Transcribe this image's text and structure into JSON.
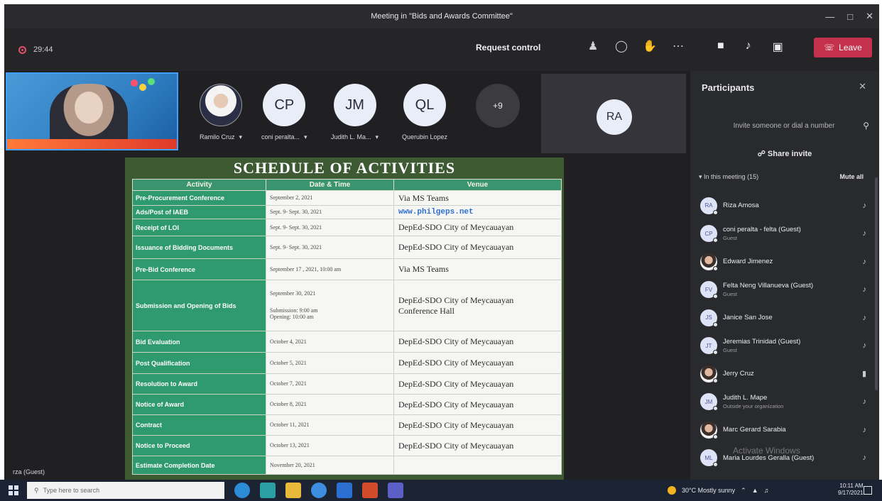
{
  "window": {
    "title": "Meeting in \"Bids and Awards Committee\"",
    "minimize_icon": "minimize-icon",
    "maximize_icon": "maximize-icon",
    "close_icon": "close-icon"
  },
  "toolbar": {
    "timer": "29:44",
    "request_control": "Request control",
    "leave_label": "Leave"
  },
  "participants_stage": [
    {
      "initials": "",
      "name": "Ramilo Cruz",
      "photo": true
    },
    {
      "initials": "CP",
      "name": "coni peralta...",
      "photo": false
    },
    {
      "initials": "JM",
      "name": "Judith L. Ma...",
      "photo": false
    },
    {
      "initials": "QL",
      "name": "Querubin Lopez",
      "photo": false
    }
  ],
  "overflow_count": "+9",
  "ra_tile": {
    "initials": "RA"
  },
  "guest_label": "rza (Guest)",
  "slide": {
    "title": "SCHEDULE OF ACTIVITIES",
    "headers": [
      "Activity",
      "Date & Time",
      "Venue"
    ],
    "rows": [
      {
        "activity": "Pre-Procurement Conference",
        "date": "September 2, 2021",
        "venue": "Via MS Teams"
      },
      {
        "activity": "Ads/Post of IAEB",
        "date": "Sept. 9- Sept. 30, 2021",
        "venue": "www.philgeps.net"
      },
      {
        "activity": "Receipt of LOI",
        "date": "Sept. 9- Sept. 30, 2021",
        "venue": "DepEd-SDO City of Meycauayan"
      },
      {
        "activity": "Issuance of Bidding Documents",
        "date": "Sept. 9- Sept. 30, 2021",
        "venue": "DepEd-SDO City of Meycauayan"
      },
      {
        "activity": "Pre-Bid Conference",
        "date": "September 17 , 2021, 10:00 am",
        "venue": "Via MS Teams"
      },
      {
        "activity": "Submission and Opening of Bids",
        "date": "September 30, 2021",
        "date2": "Submission: 9:00 am",
        "date3": "Opening: 10:00 am",
        "venue": "DepEd-SDO City of Meycauayan",
        "venue2": "Conference Hall"
      },
      {
        "activity": "Bid Evaluation",
        "date": "October 4, 2021",
        "venue": "DepEd-SDO City of Meycauayan"
      },
      {
        "activity": "Post Qualification",
        "date": "October 5, 2021",
        "venue": "DepEd-SDO City of Meycauayan"
      },
      {
        "activity": "Resolution to Award",
        "date": "October 7, 2021",
        "venue": "DepEd-SDO City of Meycauayan"
      },
      {
        "activity": "Notice of Award",
        "date": "October 8, 2021",
        "venue": "DepEd-SDO City of Meycauayan"
      },
      {
        "activity": "Contract",
        "date": "October 11, 2021",
        "venue": "DepEd-SDO City of Meycauayan"
      },
      {
        "activity": "Notice to Proceed",
        "date": "October 13, 2021",
        "venue": "DepEd-SDO City of Meycauayan"
      },
      {
        "activity": "Estimate Completion Date",
        "date": "November 20, 2021",
        "venue": ""
      }
    ]
  },
  "panel": {
    "title": "Participants",
    "invite_placeholder": "Invite someone or dial a number",
    "share_invite": "Share invite",
    "in_meeting": "In this meeting (15)",
    "mute_all": "Mute all",
    "participants": [
      {
        "initials": "RA",
        "name": "Riza Amosa",
        "sub": ""
      },
      {
        "initials": "CP",
        "name": "coni peralta - felta (Guest)",
        "sub": "Guest"
      },
      {
        "initials": "",
        "name": "Edward Jimenez",
        "sub": "",
        "photo": true
      },
      {
        "initials": "FV",
        "name": "Felta Neng Villanueva (Guest)",
        "sub": "Guest"
      },
      {
        "initials": "JS",
        "name": "Janice San Jose",
        "sub": ""
      },
      {
        "initials": "JT",
        "name": "Jeremias Trinidad (Guest)",
        "sub": "Guest"
      },
      {
        "initials": "",
        "name": "Jerry Cruz",
        "sub": "",
        "photo": true
      },
      {
        "initials": "JM",
        "name": "Judith L. Mape",
        "sub": "Outside your organization"
      },
      {
        "initials": "",
        "name": "Marc Gerard Sarabia",
        "sub": "",
        "photo": true
      },
      {
        "initials": "ML",
        "name": "Maria Lourdes Geralla (Guest)",
        "sub": ""
      }
    ],
    "watermark": "Activate Windows"
  },
  "taskbar": {
    "search_placeholder": "Type here to search",
    "weather": "30°C Mostly sunny",
    "time": "10:11 AM",
    "date": "9/17/2021"
  }
}
